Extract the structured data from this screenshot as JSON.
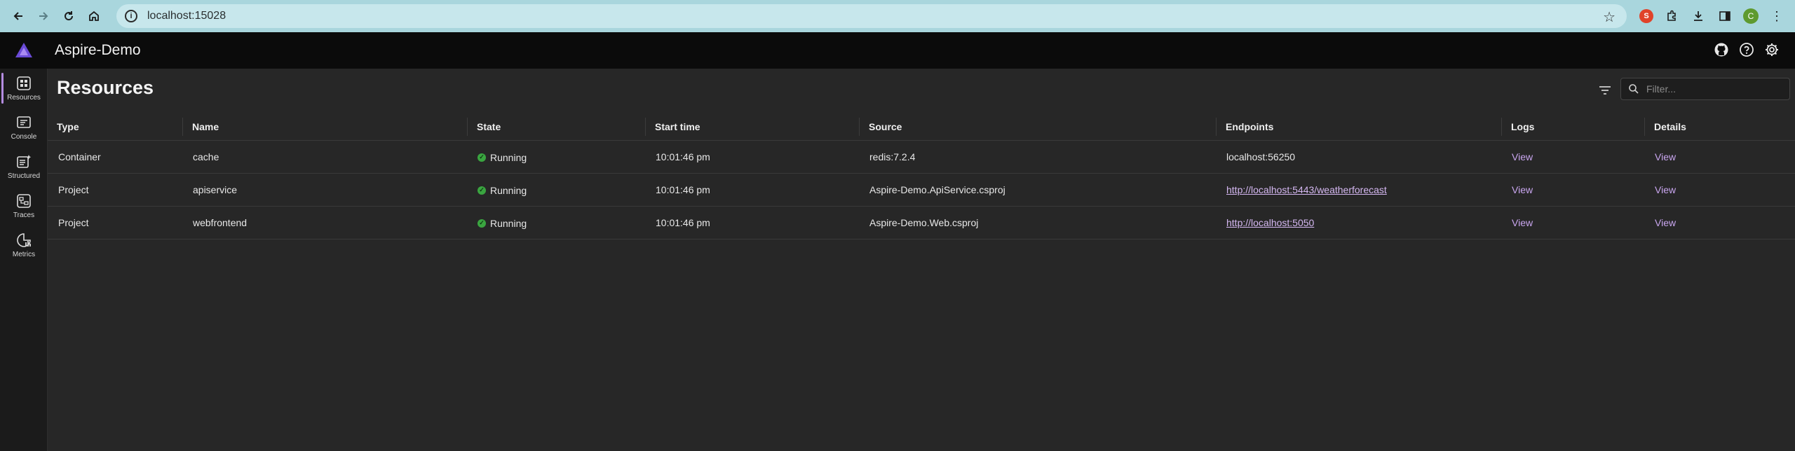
{
  "browser": {
    "url": "localhost:15028",
    "profile_initial": "C"
  },
  "app": {
    "title": "Aspire-Demo"
  },
  "sidenav": {
    "items": [
      {
        "label": "Resources",
        "icon": "grid-icon",
        "active": true
      },
      {
        "label": "Console",
        "icon": "console-icon",
        "active": false
      },
      {
        "label": "Structured",
        "icon": "structured-icon",
        "active": false
      },
      {
        "label": "Traces",
        "icon": "traces-icon",
        "active": false
      },
      {
        "label": "Metrics",
        "icon": "metrics-icon",
        "active": false
      }
    ]
  },
  "page": {
    "title": "Resources",
    "search_placeholder": "Filter..."
  },
  "table": {
    "headers": {
      "type": "Type",
      "name": "Name",
      "state": "State",
      "start": "Start time",
      "source": "Source",
      "endpoints": "Endpoints",
      "logs": "Logs",
      "details": "Details"
    },
    "rows": [
      {
        "type": "Container",
        "name": "cache",
        "state": "Running",
        "start": "10:01:46 pm",
        "source": "redis:7.2.4",
        "endpoint": "localhost:56250",
        "endpoint_is_link": false,
        "logs": "View",
        "details": "View"
      },
      {
        "type": "Project",
        "name": "apiservice",
        "state": "Running",
        "start": "10:01:46 pm",
        "source": "Aspire-Demo.ApiService.csproj",
        "endpoint": "http://localhost:5443/weatherforecast",
        "endpoint_is_link": true,
        "logs": "View",
        "details": "View"
      },
      {
        "type": "Project",
        "name": "webfrontend",
        "state": "Running",
        "start": "10:01:46 pm",
        "source": "Aspire-Demo.Web.csproj",
        "endpoint": "http://localhost:5050",
        "endpoint_is_link": true,
        "logs": "View",
        "details": "View"
      }
    ]
  },
  "colors": {
    "accent": "#b48ce0",
    "running": "#3aa540",
    "link": "#d5b8f2"
  }
}
